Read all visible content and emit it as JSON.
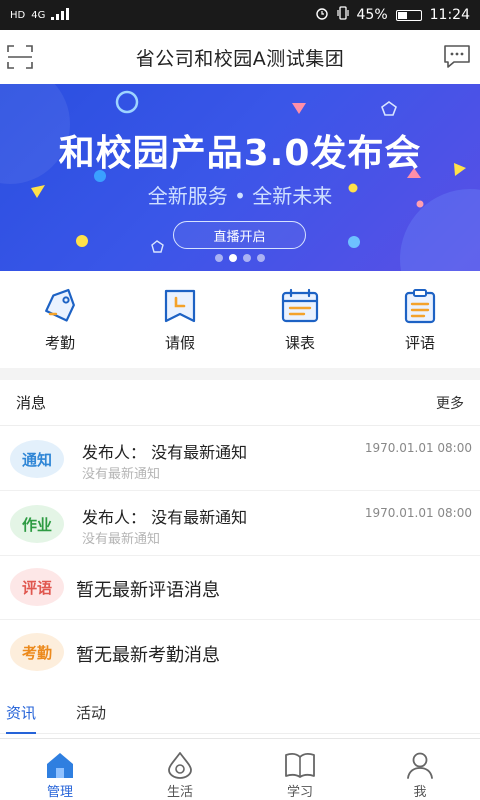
{
  "status_bar": {
    "hd": "HD",
    "network": "4G",
    "battery": "45%",
    "battery_level": 0.45,
    "time": "11:24"
  },
  "header": {
    "title": "省公司和校园A测试集团",
    "left_icon": "scan-icon",
    "right_icon": "chat-icon"
  },
  "banner": {
    "title": "和校园产品3.0发布会",
    "subtitle": "全新服务 • 全新未来",
    "button_label": "直播开启",
    "slides": 4,
    "active_slide": 2
  },
  "quick_menu": [
    {
      "label": "考勤",
      "icon": "attendance-tag-icon"
    },
    {
      "label": "请假",
      "icon": "leave-bookmark-icon"
    },
    {
      "label": "课表",
      "icon": "schedule-icon"
    },
    {
      "label": "评语",
      "icon": "comment-clipboard-icon"
    }
  ],
  "messages": {
    "title": "消息",
    "more": "更多",
    "items": [
      {
        "badge": "通知",
        "publisher": "发布人：  没有最新通知",
        "subtitle": "没有最新通知",
        "time": "1970.01.01 08:00"
      },
      {
        "badge": "作业",
        "publisher": "发布人：  没有最新通知",
        "subtitle": "没有最新通知",
        "time": "1970.01.01 08:00"
      }
    ],
    "singles": [
      {
        "badge": "评语",
        "text": "暂无最新评语消息"
      },
      {
        "badge": "考勤",
        "text": "暂无最新考勤消息"
      }
    ]
  },
  "tabs": [
    {
      "label": "资讯",
      "active": true
    },
    {
      "label": "活动",
      "active": false
    }
  ],
  "bottom_nav": [
    {
      "label": "管理",
      "icon": "home-icon",
      "active": true
    },
    {
      "label": "生活",
      "icon": "life-drop-icon",
      "active": false
    },
    {
      "label": "学习",
      "icon": "book-icon",
      "active": false
    },
    {
      "label": "我",
      "icon": "profile-icon",
      "active": false
    }
  ],
  "colors": {
    "accent": "#2563d8",
    "banner": "#3a56e8",
    "notice_badge": "#e3f0fb",
    "homework_badge": "#e4f5e6",
    "comment_badge": "#fde7e7",
    "attendance_badge": "#fdeedc"
  }
}
